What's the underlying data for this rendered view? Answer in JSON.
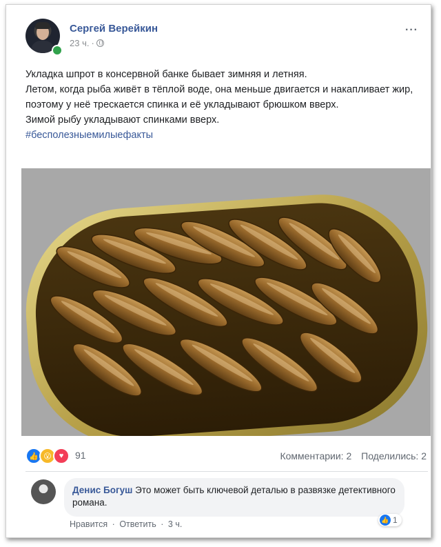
{
  "post": {
    "author": "Сергей Верейкин",
    "time": "23 ч.",
    "dot": "·",
    "more": "···",
    "paragraphs": [
      "Укладка шпрот в консервной банке бывает зимняя и летняя.",
      "Летом, когда рыба живёт в тёплой воде, она меньше двигается и накапливает жир, поэтому у неё трескается спинка и её укладывают брюшком вверх.",
      "Зимой рыбу укладывают спинками вверх."
    ],
    "hashtag": "#бесполезныемилыефакты",
    "photo_icon": "sprats-can-photo"
  },
  "reactions": {
    "types": [
      "like",
      "wow",
      "love"
    ],
    "icons": {
      "like": "👍",
      "wow": "😮",
      "love": "♥"
    },
    "count": "91",
    "comments": "Комментарии: 2",
    "shares": "Поделились: 2",
    "colors": {
      "like": "#1877f2",
      "wow": "#f7b928",
      "love": "#f33e58"
    }
  },
  "comment": {
    "author": "Денис Богуш",
    "text": "Это может быть ключевой деталью в развязке детективного романа.",
    "like_label": "Нравится",
    "reply_label": "Ответить",
    "time": "3 ч.",
    "sep": "·",
    "likes": "1"
  },
  "colors": {
    "link": "#385898",
    "text": "#1c1e21",
    "muted": "#606770"
  }
}
